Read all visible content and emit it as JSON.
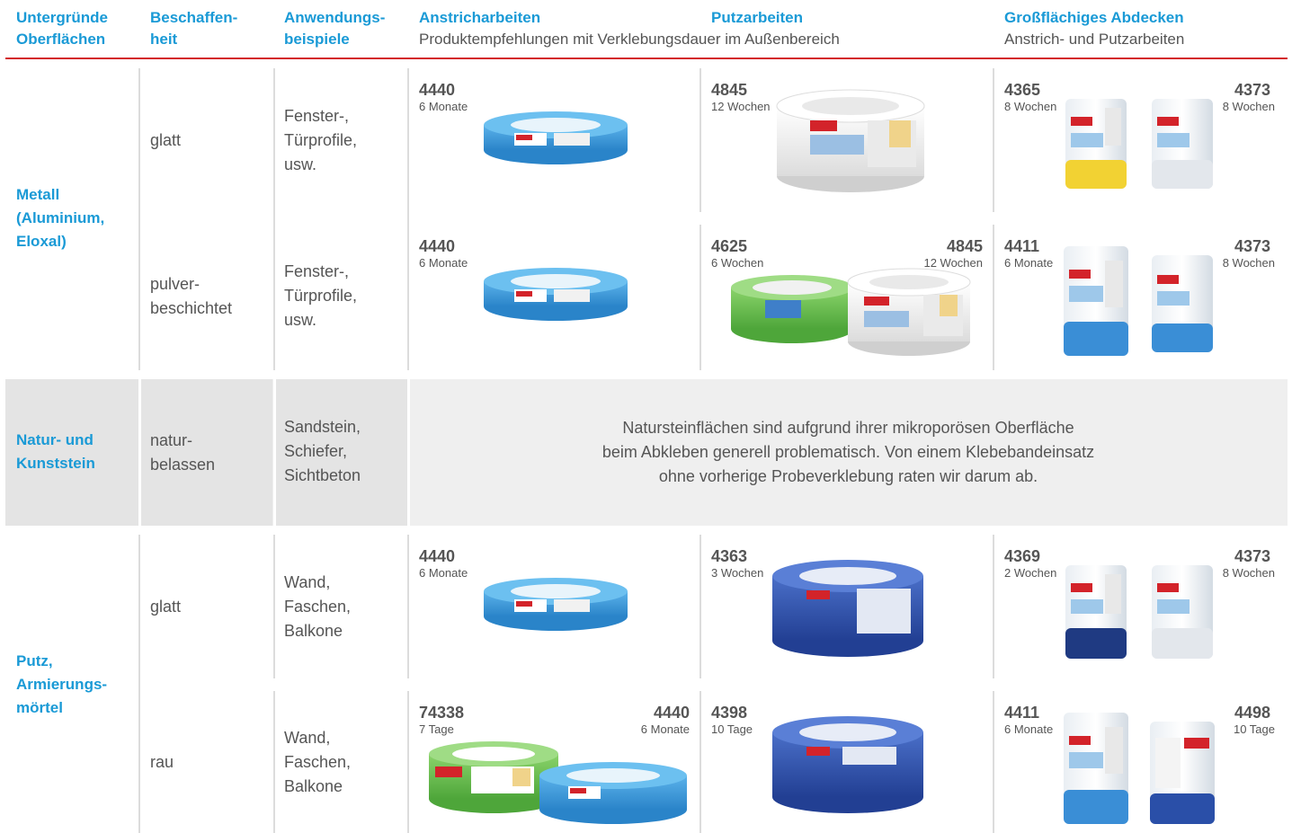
{
  "header": {
    "col1": [
      "Untergründe",
      "Oberflächen"
    ],
    "col2": [
      "Beschaffen-",
      "heit"
    ],
    "col3": [
      "Anwendungs-",
      "beispiele"
    ],
    "col4_title": "Anstricharbeiten",
    "col5_title": "Putzarbeiten",
    "col45_sub": "Produktempfehlungen mit Verklebungsdauer im Außenbereich",
    "col6_title": "Großflächiges Abdecken",
    "col6_sub": "Anstrich- und Putzarbeiten"
  },
  "materials": {
    "metal": [
      "Metall",
      "(Aluminium,",
      "Eloxal)"
    ],
    "stone": [
      "Natur- und",
      "Kunststein"
    ],
    "plaster": [
      "Putz,",
      "Armierungs-",
      "mörtel"
    ]
  },
  "surfaces": {
    "r1": [
      "glatt"
    ],
    "r2": [
      "pulver-",
      "beschichtet"
    ],
    "r3": [
      "natur-",
      "belassen"
    ],
    "r4": [
      "glatt"
    ],
    "r5": [
      "rau"
    ]
  },
  "applications": {
    "r1": [
      "Fenster-,",
      "Türprofile,",
      "usw."
    ],
    "r2": [
      "Fenster-,",
      "Türprofile,",
      "usw."
    ],
    "r3": [
      "Sandstein,",
      "Schiefer,",
      "Sichtbeton"
    ],
    "r4": [
      "Wand,",
      "Faschen,",
      "Balkone"
    ],
    "r5": [
      "Wand,",
      "Faschen,",
      "Balkone"
    ]
  },
  "stone_note": [
    "Natursteinflächen sind aufgrund ihrer mikroporösen Oberfläche",
    "beim Abkleben generell problematisch. Von einem Klebebandeinsatz",
    "ohne vorherige Probeverklebung raten wir darum ab."
  ],
  "products": {
    "r1": {
      "paint": [
        {
          "code": "4440",
          "duration": "6 Monate"
        }
      ],
      "plaster": [
        {
          "code": "4845",
          "duration": "12 Wochen"
        }
      ],
      "cover": [
        {
          "code": "4365",
          "duration": "8 Wochen"
        },
        {
          "code": "4373",
          "duration": "8 Wochen"
        }
      ]
    },
    "r2": {
      "paint": [
        {
          "code": "4440",
          "duration": "6 Monate"
        }
      ],
      "plaster": [
        {
          "code": "4625",
          "duration": "6 Wochen"
        },
        {
          "code": "4845",
          "duration": "12 Wochen"
        }
      ],
      "cover": [
        {
          "code": "4411",
          "duration": "6 Monate"
        },
        {
          "code": "4373",
          "duration": "8 Wochen"
        }
      ]
    },
    "r4": {
      "paint": [
        {
          "code": "4440",
          "duration": "6 Monate"
        }
      ],
      "plaster": [
        {
          "code": "4363",
          "duration": "3 Wochen"
        }
      ],
      "cover": [
        {
          "code": "4369",
          "duration": "2 Wochen"
        },
        {
          "code": "4373",
          "duration": "8 Wochen"
        }
      ]
    },
    "r5": {
      "paint": [
        {
          "code": "74338",
          "duration": "7 Tage"
        },
        {
          "code": "4440",
          "duration": "6 Monate"
        }
      ],
      "plaster": [
        {
          "code": "4398",
          "duration": "10 Tage"
        }
      ],
      "cover": [
        {
          "code": "4411",
          "duration": "6 Monate"
        },
        {
          "code": "4498",
          "duration": "10 Tage"
        }
      ]
    }
  },
  "brand": {
    "logo_text": "tesa",
    "colors": {
      "accent_blue": "#1a9ad6",
      "header_rule": "#d3232a",
      "tape_blue": "#3a97d8",
      "tape_green": "#6cc04a",
      "tape_navy": "#2a4fa8",
      "tesa_red": "#d3232a"
    }
  }
}
